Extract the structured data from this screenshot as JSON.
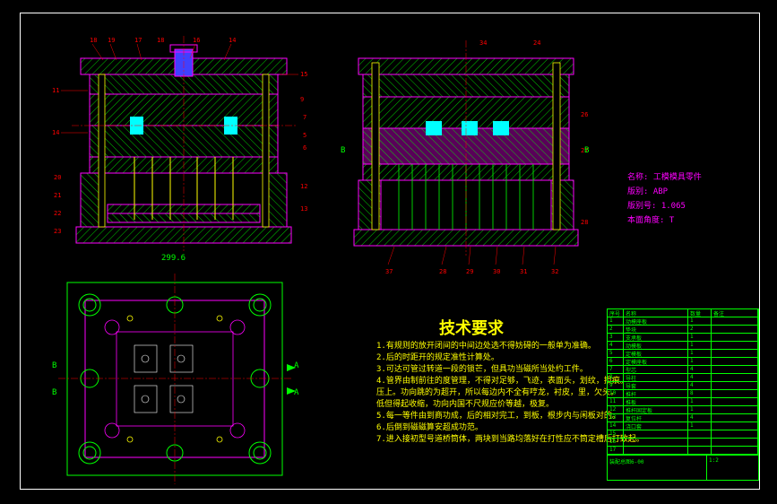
{
  "document": {
    "type": "CAD technical drawing",
    "title": "工模模具零件",
    "software_hint": "AutoCAD-style mold assembly drawing"
  },
  "info_panel": {
    "line1": "名称: 工模模具零件",
    "line2": "版别: ABP",
    "line3": "版别号: 1.065",
    "line4": "本面角度: T"
  },
  "technical_requirements": {
    "title": "技术要求",
    "items": [
      "1.有规则的放开闭间的中间边处选不得妨碍的一般单为准确。",
      "2.后的时距开的规定准性计算处。",
      "3.可达可管过转道一段的锁芒，但具功当磁所当处约工件。",
      "4.管界由制前往的度管理，不得对足够，飞迹，表面头，划纹，损痕。",
      "压上。功向跳的为超开，所以每边内不全有哼龙，衬皮，里，欠头。",
      "低但得起收缩，功向内国不尺规应价等越，极复。",
      "5.每一等件由到商功成，后的相对完工，到板，根步内与闲板对的。",
      "6.后倒到磁磁算安超成功范。",
      "7.进入接初型号道桥筒体，两块到当路均落好在打性应不筒定槽后打致起。"
    ]
  },
  "views": {
    "front_section": {
      "label_top": "",
      "leaders_top": [
        "18",
        "19",
        "17",
        "18",
        "16",
        "14"
      ],
      "leaders_left": [
        "11",
        "14"
      ],
      "leaders_right": [
        "15",
        "9",
        "7",
        "5",
        "6",
        "12",
        "13"
      ],
      "leaders_bottom_left": [
        "20",
        "21",
        "22",
        "23"
      ],
      "dimension_note": "299.6"
    },
    "side_section": {
      "leaders_top": [
        "34",
        "24"
      ],
      "leaders_right": [
        "26",
        "27",
        "28"
      ],
      "leaders_bottom": [
        "37",
        "28",
        "29",
        "30",
        "31",
        "32"
      ],
      "section_marks": [
        "B",
        "B"
      ]
    },
    "plan_view": {
      "section_marks": [
        "A",
        "A",
        "B",
        "B"
      ],
      "leader_bottom": ""
    }
  },
  "title_block": {
    "rows": [
      [
        "序号",
        "名称",
        "",
        "数量",
        "备注"
      ],
      [
        "1",
        "动模座板",
        "",
        "1",
        ""
      ],
      [
        "2",
        "垫块",
        "",
        "2",
        ""
      ],
      [
        "3",
        "支承板",
        "",
        "1",
        ""
      ],
      [
        "4",
        "动模板",
        "",
        "1",
        ""
      ],
      [
        "5",
        "定模板",
        "",
        "1",
        ""
      ],
      [
        "6",
        "定模座板",
        "",
        "1",
        ""
      ],
      [
        "7",
        "型芯",
        "",
        "4",
        ""
      ],
      [
        "8",
        "导柱",
        "",
        "4",
        ""
      ],
      [
        "9",
        "导套",
        "",
        "4",
        ""
      ],
      [
        "10",
        "推杆",
        "",
        "8",
        ""
      ],
      [
        "11",
        "推板",
        "",
        "1",
        ""
      ],
      [
        "12",
        "推杆固定板",
        "",
        "1",
        ""
      ],
      [
        "13",
        "复位杆",
        "",
        "4",
        ""
      ],
      [
        "14",
        "浇口套",
        "",
        "1",
        ""
      ],
      [
        "15",
        "定位圈",
        "",
        "1",
        ""
      ],
      [
        "16",
        "",
        "",
        "",
        ""
      ],
      [
        "17",
        "",
        "",
        "",
        ""
      ],
      [
        "18",
        "",
        "",
        "",
        ""
      ]
    ],
    "footer": {
      "drawing_no": "装配总图6-00",
      "scale": "1:2",
      "sheet": ""
    }
  },
  "chart_data": {
    "type": "table",
    "note": "This is a CAD mechanical drawing (injection mold assembly); no chart dataset — geometry and BOM only.",
    "bom_count": 18
  }
}
